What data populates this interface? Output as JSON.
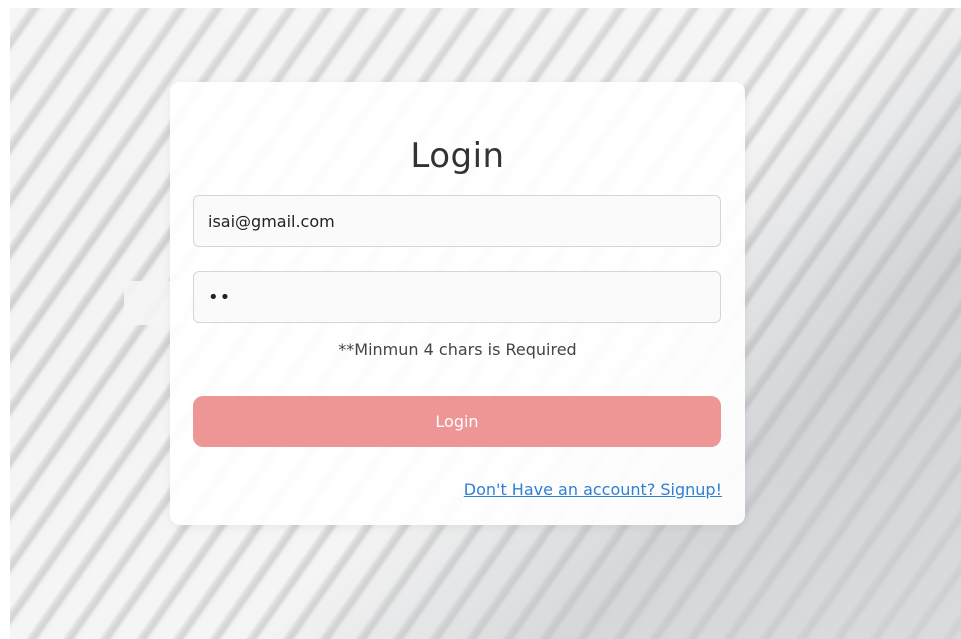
{
  "login_form": {
    "title": "Login",
    "email_value": "isai@gmail.com",
    "password_value": "••",
    "error_message": "**Minmun 4 chars is Required",
    "login_button_label": "Login",
    "signup_link_label": "Don't Have an account? Signup!"
  },
  "colors": {
    "button_bg": "#ee9596",
    "link": "#2f7fd6"
  }
}
